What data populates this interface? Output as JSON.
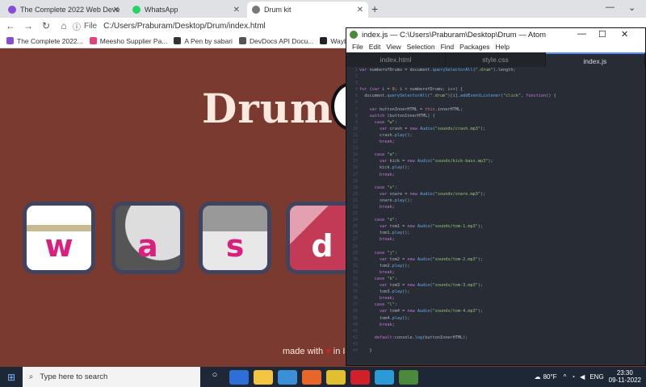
{
  "browser": {
    "tabs": [
      {
        "label": "The Complete 2022 Web Develo",
        "color": "#8a4bd8",
        "active": false
      },
      {
        "label": "WhatsApp",
        "color": "#25d366",
        "active": false
      },
      {
        "label": "Drum kit",
        "color": "#777777",
        "active": true
      }
    ],
    "address": "C:/Users/Praburam/Desktop/Drum/index.html",
    "file_label": "File",
    "bookmarks": [
      {
        "label": "The Complete 2022...",
        "color": "#8a4bd8"
      },
      {
        "label": "Meesho Supplier Pa...",
        "color": "#e8407a"
      },
      {
        "label": "A Pen by sabari",
        "color": "#333333"
      },
      {
        "label": "DevDocs API Docu...",
        "color": "#555555"
      },
      {
        "label": "Wayback Ma",
        "color": "#222222"
      }
    ]
  },
  "page": {
    "title": "Drum",
    "drums": [
      {
        "key": "w",
        "bg": "#c9b98f"
      },
      {
        "key": "a",
        "bg": "#8a8a8a"
      },
      {
        "key": "s",
        "bg": "#b5b5b5"
      },
      {
        "key": "d",
        "bg": "#c23a56"
      }
    ],
    "footer_text": "made with",
    "footer_tail": "in I"
  },
  "atom": {
    "title": "index.js — C:\\Users\\Praburam\\Desktop\\Drum — Atom",
    "menu": [
      "File",
      "Edit",
      "View",
      "Selection",
      "Find",
      "Packages",
      "Help"
    ],
    "tabs": [
      {
        "label": "index.html",
        "active": false
      },
      {
        "label": "style.css",
        "active": false
      },
      {
        "label": "index.js",
        "active": true
      }
    ]
  },
  "taskbar": {
    "search_placeholder": "Type here to search",
    "weather": "80°F",
    "lang": "ENG",
    "time": "23:30",
    "date": "09-11-2022"
  }
}
